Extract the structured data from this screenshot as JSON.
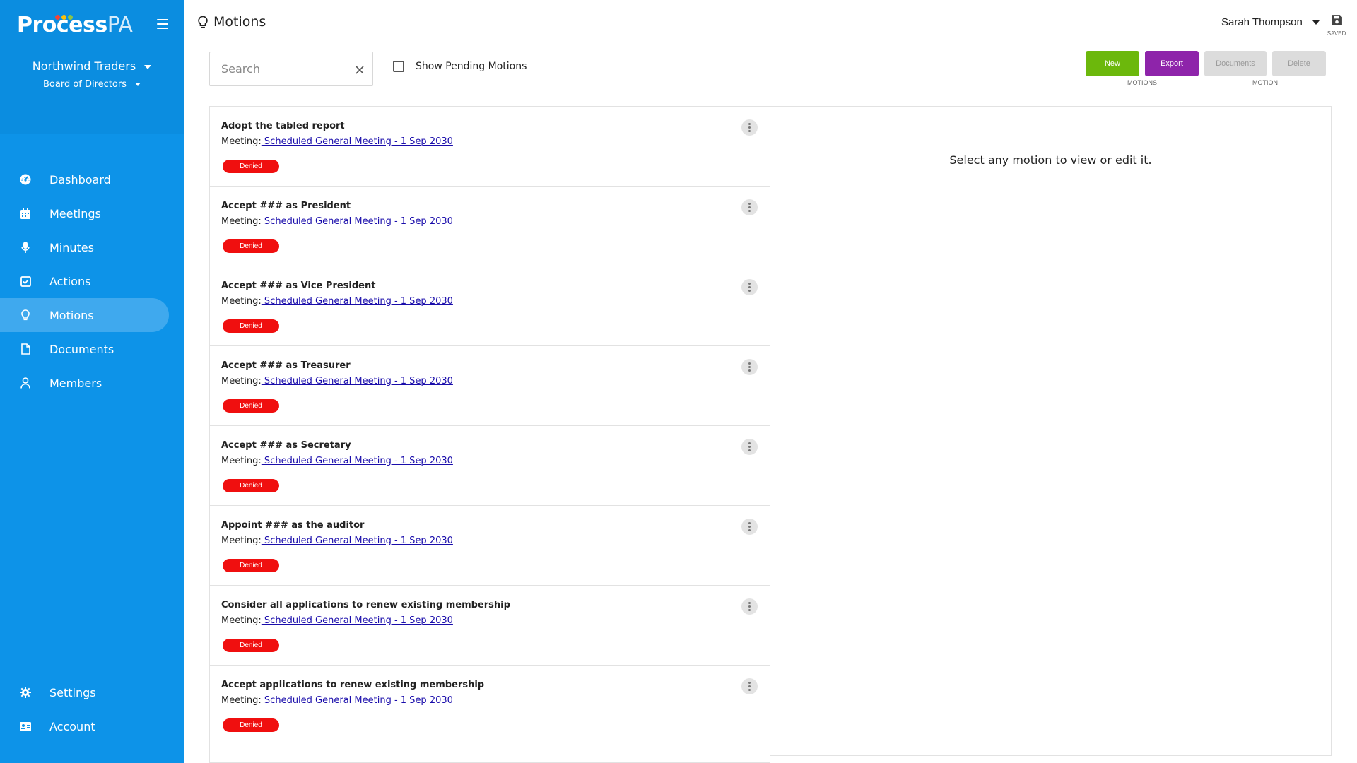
{
  "app": {
    "logo_main": "Process",
    "logo_suffix": "PA",
    "logo_dot_colors": [
      "#f44336",
      "#ffc107",
      "#8bc34a"
    ]
  },
  "sidebar": {
    "organization": "Northwind Traders",
    "committee": "Board of Directors",
    "items": [
      {
        "label": "Dashboard",
        "icon": "dashboard-icon"
      },
      {
        "label": "Meetings",
        "icon": "calendar-icon"
      },
      {
        "label": "Minutes",
        "icon": "microphone-icon"
      },
      {
        "label": "Actions",
        "icon": "checkbox-icon"
      },
      {
        "label": "Motions",
        "icon": "lightbulb-icon",
        "active": true
      },
      {
        "label": "Documents",
        "icon": "document-icon"
      },
      {
        "label": "Members",
        "icon": "person-icon"
      }
    ],
    "bottom_items": [
      {
        "label": "Settings",
        "icon": "gear-icon"
      },
      {
        "label": "Account",
        "icon": "id-card-icon"
      }
    ]
  },
  "header": {
    "title": "Motions",
    "user_name": "Sarah Thompson",
    "saved_label": "SAVED"
  },
  "toolbar": {
    "search_placeholder": "Search",
    "show_pending_label": "Show Pending Motions",
    "new_label": "New",
    "export_label": "Export",
    "documents_label": "Documents",
    "delete_label": "Delete",
    "motions_group_label": "MOTIONS",
    "motion_group_label": "MOTION"
  },
  "motions": {
    "meeting_prefix": "Meeting:",
    "items": [
      {
        "title": "Adopt the tabled report",
        "meeting": " Scheduled General Meeting - 1 Sep 2030",
        "status": "Denied"
      },
      {
        "title": "Accept ### as President",
        "meeting": " Scheduled General Meeting - 1 Sep 2030",
        "status": "Denied"
      },
      {
        "title": "Accept ### as Vice President",
        "meeting": " Scheduled General Meeting - 1 Sep 2030",
        "status": "Denied"
      },
      {
        "title": "Accept ### as Treasurer",
        "meeting": " Scheduled General Meeting - 1 Sep 2030",
        "status": "Denied"
      },
      {
        "title": "Accept ### as Secretary",
        "meeting": " Scheduled General Meeting - 1 Sep 2030",
        "status": "Denied"
      },
      {
        "title": "Appoint ### as the auditor",
        "meeting": " Scheduled General Meeting - 1 Sep 2030",
        "status": "Denied"
      },
      {
        "title": "Consider all applications to renew existing membership",
        "meeting": " Scheduled General Meeting - 1 Sep 2030",
        "status": "Denied"
      },
      {
        "title": "Accept applications to renew existing membership",
        "meeting": " Scheduled General Meeting - 1 Sep 2030",
        "status": "Denied"
      }
    ]
  },
  "detail": {
    "empty_message": "Select any motion to view or edit it."
  }
}
